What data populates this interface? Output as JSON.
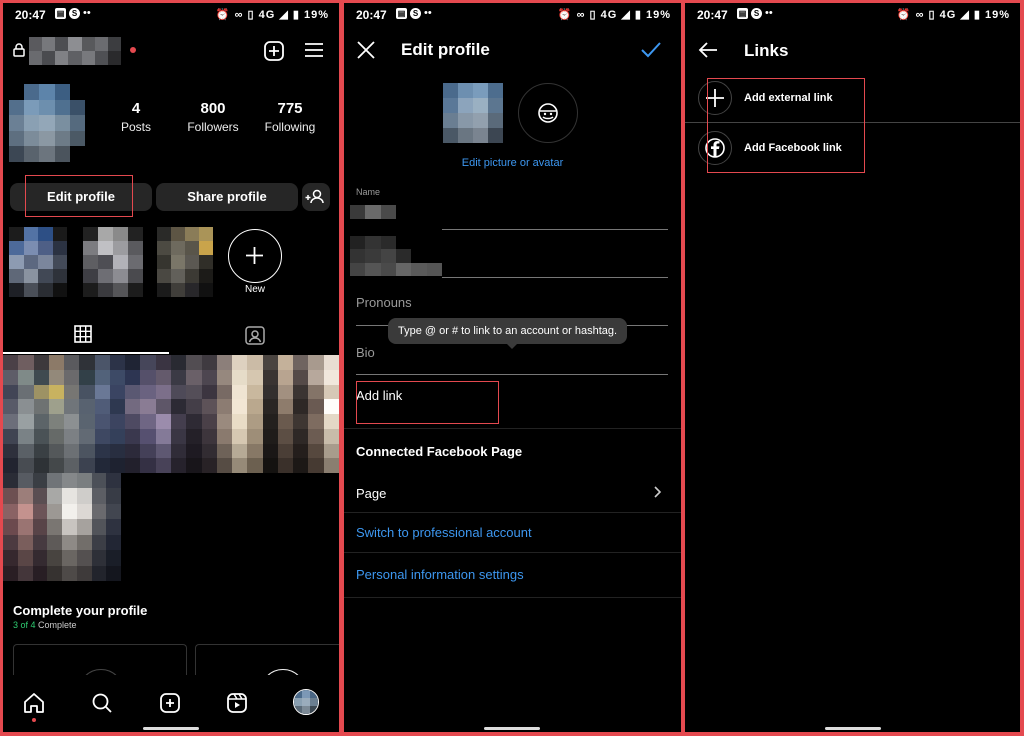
{
  "status_bar": {
    "time": "20:47",
    "battery": "19%",
    "network": "4G"
  },
  "profile_screen": {
    "stats": [
      {
        "value": "4",
        "label": "Posts"
      },
      {
        "value": "800",
        "label": "Followers"
      },
      {
        "value": "775",
        "label": "Following"
      }
    ],
    "edit_profile_label": "Edit profile",
    "share_profile_label": "Share profile",
    "new_highlight_label": "New",
    "complete_title": "Complete your profile",
    "complete_progress": "3 of 4",
    "complete_suffix": " Complete"
  },
  "edit_profile_screen": {
    "title": "Edit profile",
    "edit_picture_label": "Edit picture or avatar",
    "name_label": "Name",
    "pronouns_placeholder": "Pronouns",
    "bio_placeholder": "Bio",
    "tooltip_text": "Type @ or # to link to an account or hashtag.",
    "add_link_label": "Add link",
    "connected_fb_heading": "Connected Facebook Page",
    "page_label": "Page",
    "switch_professional_label": "Switch to professional account",
    "personal_info_label": "Personal information settings"
  },
  "links_screen": {
    "title": "Links",
    "add_external_label": "Add external link",
    "add_facebook_label": "Add Facebook link"
  },
  "colors": {
    "accent_blue": "#3d97f0",
    "highlight_red": "#e4494f",
    "background": "#000000",
    "button_gray": "#262626"
  }
}
